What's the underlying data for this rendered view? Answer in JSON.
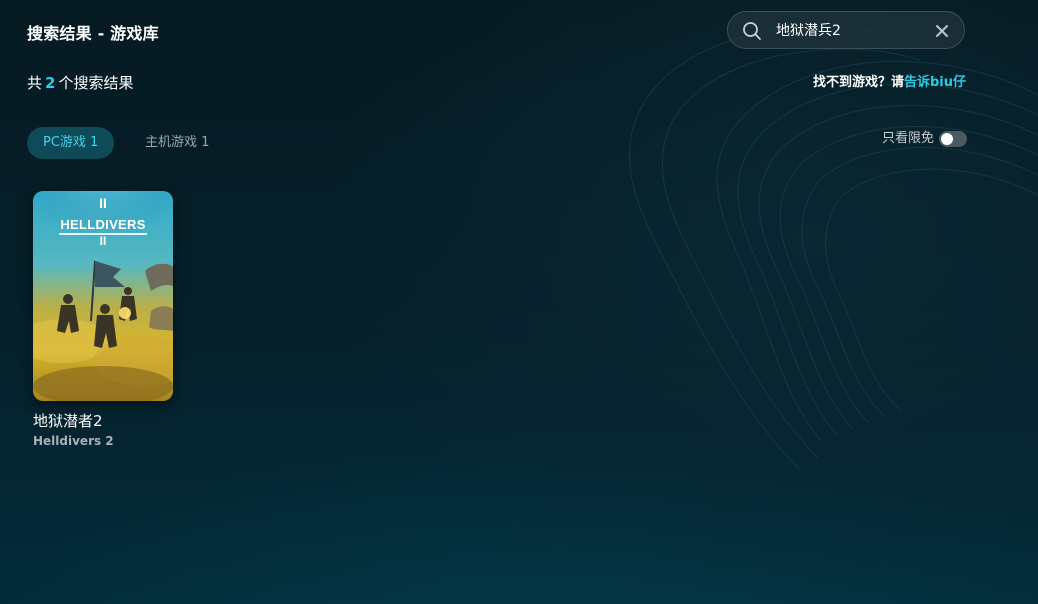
{
  "header": {
    "title": "搜索结果 - 游戏库"
  },
  "search": {
    "value": "地狱潜兵2",
    "icon": "search-icon",
    "clear_icon": "close-icon"
  },
  "results": {
    "prefix": "共",
    "count": "2",
    "suffix": "个搜索结果"
  },
  "help": {
    "text": "找不到游戏？请",
    "link": "告诉biu仔"
  },
  "tabs": [
    {
      "label": "PC游戏 1",
      "active": true
    },
    {
      "label": "主机游戏 1",
      "active": false
    }
  ],
  "filter": {
    "label": "只看限免",
    "enabled": false
  },
  "games": [
    {
      "title": "地狱潜者2",
      "subtitle": "Helldivers 2",
      "cover_logo": "HELLDIVERS",
      "cover_numeral": "II"
    }
  ],
  "colors": {
    "accent": "#2fc9e6",
    "tab_active_bg": "#0e4a58",
    "background": "#061a22"
  }
}
